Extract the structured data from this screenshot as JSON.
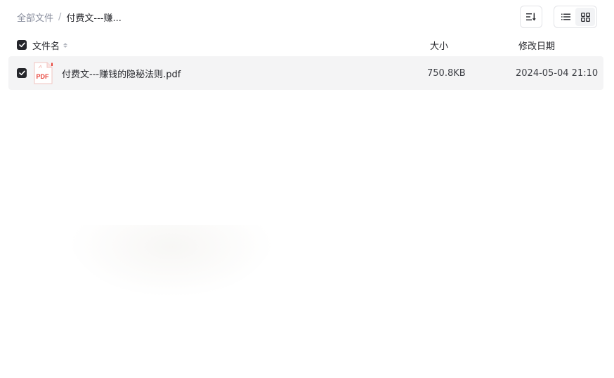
{
  "breadcrumb": {
    "root": "全部文件",
    "separator": "/",
    "current": "付费文---赚..."
  },
  "toolbar": {
    "sort_icon": "sort-icon",
    "list_view_icon": "list-view-icon",
    "grid_view_icon": "grid-view-icon",
    "active_view": "list"
  },
  "table": {
    "headers": {
      "name": "文件名",
      "size": "大小",
      "date": "修改日期"
    },
    "rows": [
      {
        "icon": "pdf-file-icon",
        "icon_label": "PDF",
        "name": "付费文---赚钱的隐秘法则.pdf",
        "size": "750.8KB",
        "date": "2024-05-04 21:10",
        "checked": true
      }
    ]
  },
  "colors": {
    "checkbox": "#25262b",
    "row_background": "#f4f4f5",
    "pdf_red": "#e8453c",
    "muted_text": "#878c9c"
  }
}
